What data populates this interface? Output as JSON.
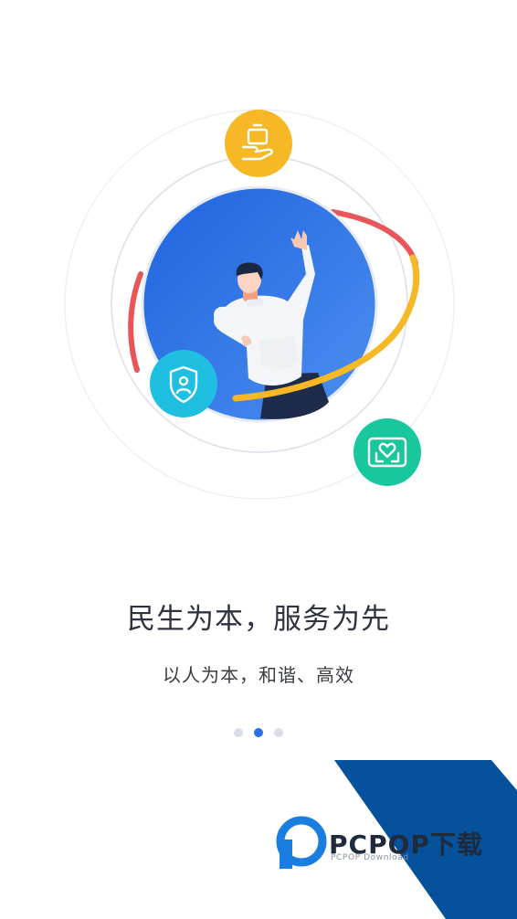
{
  "onboarding": {
    "title": "民生为本，服务为先",
    "subtitle": "以人为本，和谐、高效",
    "page_count": 3,
    "active_page": 2
  },
  "icons": {
    "top": "hand-holding-box-icon",
    "left": "shield-user-icon",
    "right": "heart-care-card-icon"
  },
  "colors": {
    "primary_blue": "#2b6fe3",
    "icon_yellow": "#f7b825",
    "icon_cyan": "#1ebfe0",
    "icon_green": "#18c79c",
    "arc_red": "#e8565a"
  },
  "watermark": {
    "brand": "PCPOP下载",
    "tagline": "PCPOP Download"
  }
}
